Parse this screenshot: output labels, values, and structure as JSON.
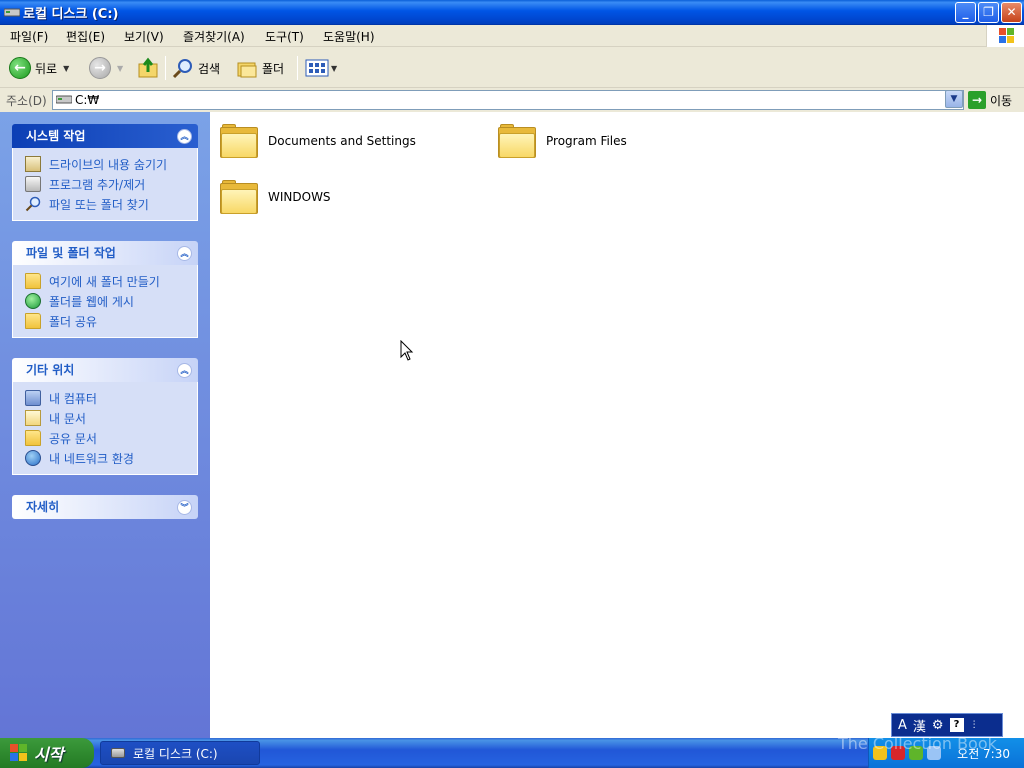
{
  "window": {
    "title": "로컬 디스크 (C:)"
  },
  "menu": {
    "items": [
      "파일(F)",
      "편집(E)",
      "보기(V)",
      "즐겨찾기(A)",
      "도구(T)",
      "도움말(H)"
    ]
  },
  "toolbar": {
    "back_label": "뒤로",
    "search_label": "검색",
    "folders_label": "폴더"
  },
  "address": {
    "label": "주소(D)",
    "value": "C:₩",
    "go_label": "이동"
  },
  "taskpane": {
    "system_tasks": {
      "title": "시스템 작업",
      "items": [
        "드라이브의 내용 숨기기",
        "프로그램 추가/제거",
        "파일 또는 폴더 찾기"
      ]
    },
    "file_folder_tasks": {
      "title": "파일 및 폴더 작업",
      "items": [
        "여기에 새 폴더 만들기",
        "폴더를 웹에 게시",
        "폴더 공유"
      ]
    },
    "other_places": {
      "title": "기타 위치",
      "items": [
        "내 컴퓨터",
        "내 문서",
        "공유 문서",
        "내 네트워크 환경"
      ]
    },
    "details": {
      "title": "자세히"
    }
  },
  "content": {
    "folders": [
      "Documents and Settings",
      "Program Files",
      "WINDOWS"
    ]
  },
  "ime": {
    "mode_a": "A",
    "mode_hanja": "漢"
  },
  "taskbar": {
    "start_label": "시작",
    "task_label": "로컬 디스크 (C:)",
    "clock": "오전 7:30"
  },
  "watermark": "The Collection Book",
  "colors": {
    "titlebar": "#0055e5",
    "taskpane": "#7ba2e7",
    "link": "#215dc6",
    "start": "#2f8a2f"
  }
}
